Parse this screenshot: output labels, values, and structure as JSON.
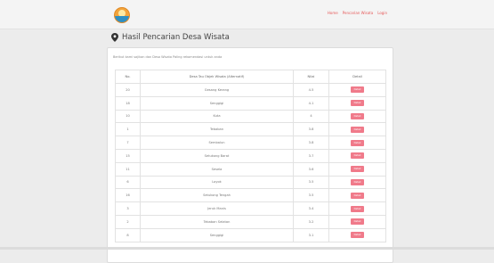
{
  "nav": {
    "links": [
      "Home",
      "Pencarian Wisata",
      "Login"
    ]
  },
  "page": {
    "title": "Hasil Pencarian Desa Wisata"
  },
  "card": {
    "intro": "Berikut kami sajikan dan Desa Wisata Paling rekomendasi untuk anda"
  },
  "table": {
    "headers": [
      "No.",
      "Desa Tau Objek Wisata (Alternatif)",
      "Nilai",
      "Detail"
    ],
    "button_label": "Detail",
    "rows": [
      [
        "20",
        "Gesang Kerang",
        "4.5"
      ],
      [
        "18",
        "Senggigi",
        "4.1"
      ],
      [
        "10",
        "Kuta",
        "4"
      ],
      [
        "1",
        "Tebaban",
        "3.8"
      ],
      [
        "7",
        "Sembalun",
        "3.8"
      ],
      [
        "15",
        "Setukong Barat",
        "3.7"
      ],
      [
        "11",
        "Sesela",
        "3.6"
      ],
      [
        "6",
        "Loyok",
        "3.5"
      ],
      [
        "16",
        "Setukong Tengah",
        "3.5"
      ],
      [
        "3",
        "Jeruk Manis",
        "3.4"
      ],
      [
        "2",
        "Tebaban Selatan",
        "3.2"
      ],
      [
        "8",
        "Senggigi",
        "3.1"
      ]
    ]
  },
  "colors": {
    "accent": "#e65a5a",
    "button": "#f07a8a"
  }
}
